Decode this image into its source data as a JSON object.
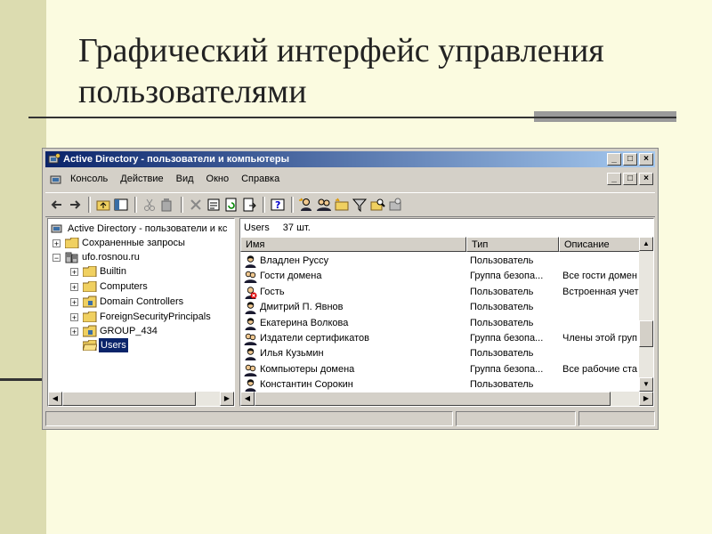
{
  "slide": {
    "title": "Графический интерфейс управления пользователями"
  },
  "window": {
    "title": "Active Directory - пользователи и компьютеры",
    "controls": {
      "minimize": "_",
      "maximize": "□",
      "close": "×"
    }
  },
  "menu": {
    "items": [
      "Консоль",
      "Действие",
      "Вид",
      "Окно",
      "Справка"
    ]
  },
  "toolbar": {
    "icons": [
      "back-arrow-icon",
      "forward-arrow-icon",
      "up-folder-icon",
      "show-tree-icon",
      "cut-icon",
      "copy-icon",
      "delete-icon",
      "properties-icon",
      "refresh-icon",
      "export-icon",
      "help-icon",
      "new-user-icon",
      "new-group-icon",
      "new-ou-icon",
      "filter-icon",
      "find-icon",
      "add-to-group-icon"
    ]
  },
  "tree": {
    "root": "Active Directory - пользователи и кс",
    "items": [
      {
        "label": "Сохраненные запросы",
        "expander": "+"
      },
      {
        "label": "ufo.rosnou.ru",
        "expander": "−"
      },
      {
        "label": "Builtin",
        "expander": "+"
      },
      {
        "label": "Computers",
        "expander": "+"
      },
      {
        "label": "Domain Controllers",
        "expander": "+"
      },
      {
        "label": "ForeignSecurityPrincipals",
        "expander": "+"
      },
      {
        "label": "GROUP_434",
        "expander": "+"
      },
      {
        "label": "Users",
        "expander": ""
      }
    ]
  },
  "list": {
    "container": "Users",
    "count": "37 шт.",
    "columns": [
      "Имя",
      "Тип",
      "Описание"
    ],
    "rows": [
      {
        "name": "Владлен Руссу",
        "type": "Пользователь",
        "desc": "",
        "icon": "user"
      },
      {
        "name": "Гости домена",
        "type": "Группа безопа...",
        "desc": "Все гости домен",
        "icon": "group"
      },
      {
        "name": "Гость",
        "type": "Пользователь",
        "desc": "Встроенная учет",
        "icon": "disabled-user"
      },
      {
        "name": "Дмитрий П. Явнов",
        "type": "Пользователь",
        "desc": "",
        "icon": "user"
      },
      {
        "name": "Екатерина Волкова",
        "type": "Пользователь",
        "desc": "",
        "icon": "user"
      },
      {
        "name": "Издатели сертификатов",
        "type": "Группа безопа...",
        "desc": "Члены этой груп",
        "icon": "group"
      },
      {
        "name": "Илья Кузьмин",
        "type": "Пользователь",
        "desc": "",
        "icon": "user"
      },
      {
        "name": "Компьютеры домена",
        "type": "Группа безопа...",
        "desc": "Все рабочие ста",
        "icon": "group"
      },
      {
        "name": "Константин Сорокин",
        "type": "Пользователь",
        "desc": "",
        "icon": "user"
      }
    ]
  },
  "colors": {
    "slide_bg": "#fbfbe0",
    "accent_bar": "#dcdcb0",
    "titlebar_start": "#0a246a",
    "titlebar_end": "#a6caf0",
    "selection": "#0a246a"
  }
}
